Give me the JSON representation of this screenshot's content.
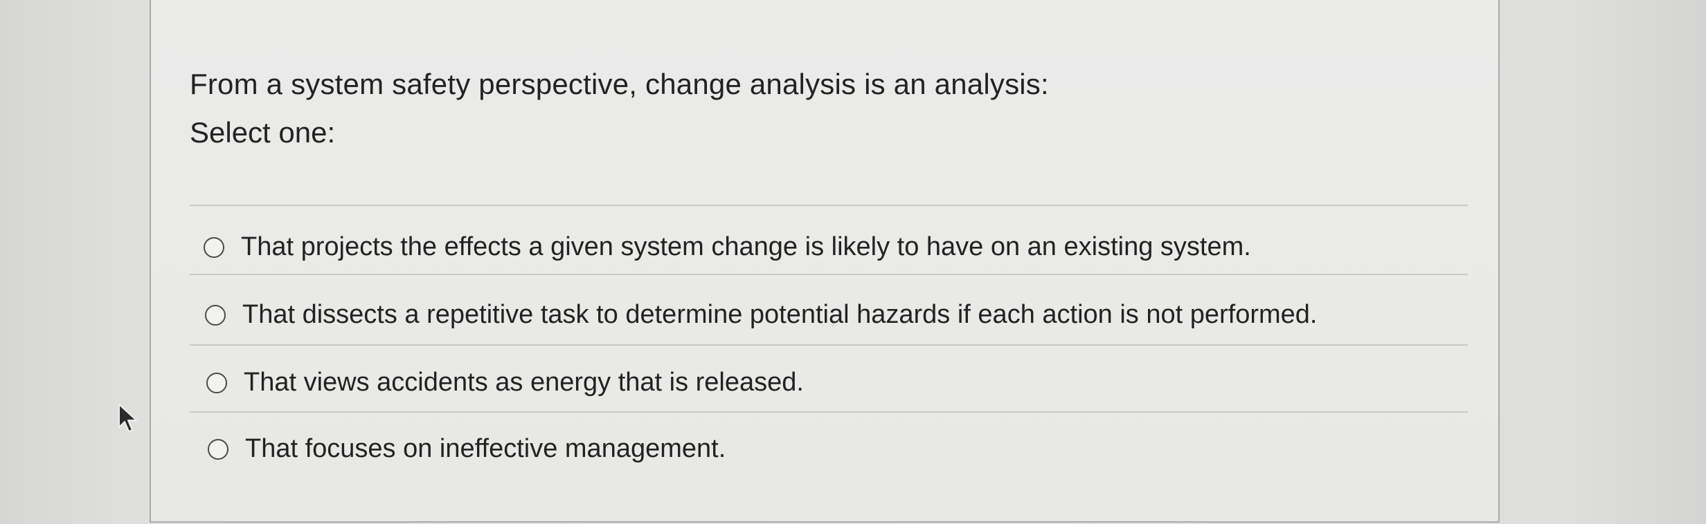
{
  "question": {
    "prompt": "From a system safety perspective, change analysis is an analysis:",
    "instruction": "Select one:"
  },
  "options": [
    {
      "label": "That projects the effects a given system change is likely to have on an existing system.",
      "selected": false
    },
    {
      "label": "That dissects a repetitive task to determine potential hazards if each action is not performed.",
      "selected": false
    },
    {
      "label": "That views accidents as energy that is released.",
      "selected": false
    },
    {
      "label": "That focuses on ineffective management.",
      "selected": false
    }
  ],
  "icons": {
    "radio": "radio-unchecked-icon",
    "cursor": "mouse-pointer-icon"
  },
  "colors": {
    "page_background": "#e0e0de",
    "card_background": "#eaeae8",
    "card_border": "#a9a9a7",
    "text": "#222222"
  }
}
